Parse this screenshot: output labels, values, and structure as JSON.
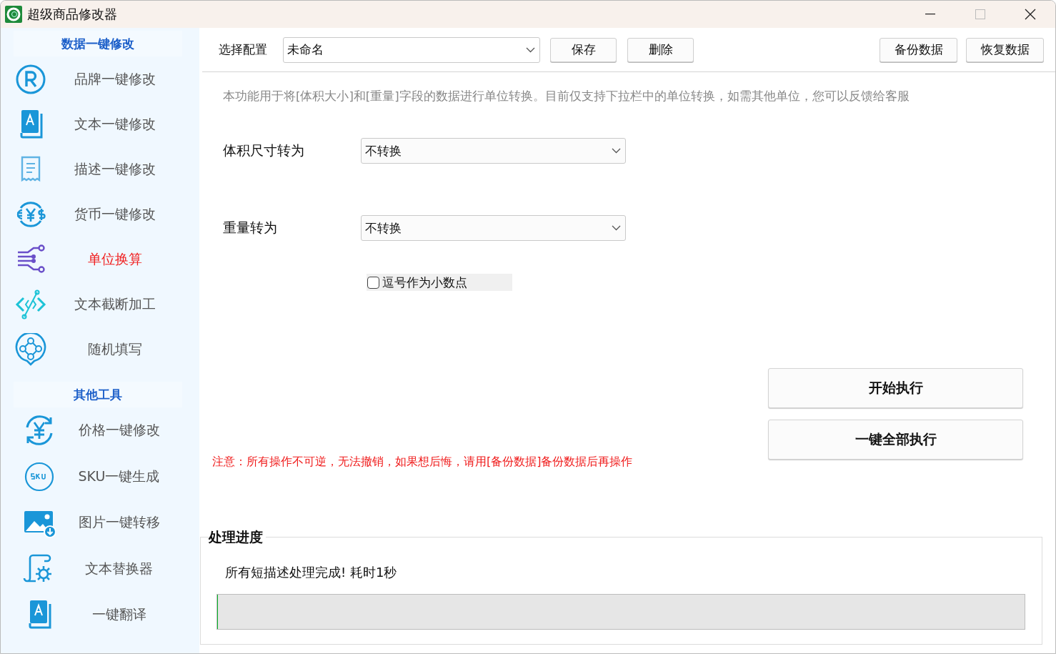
{
  "window": {
    "title": "超级商品修改器"
  },
  "sidebar": {
    "groups": [
      {
        "header": "数据一键修改",
        "items": [
          {
            "label": "品牌一键修改",
            "selected": false
          },
          {
            "label": "文本一键修改",
            "selected": false
          },
          {
            "label": "描述一键修改",
            "selected": false
          },
          {
            "label": "货币一键修改",
            "selected": false
          },
          {
            "label": "单位换算",
            "selected": true
          },
          {
            "label": "文本截断加工",
            "selected": false
          },
          {
            "label": "随机填写",
            "selected": false
          }
        ]
      },
      {
        "header": "其他工具",
        "items": [
          {
            "label": "价格一键修改",
            "selected": false
          },
          {
            "label": "SKU一键生成",
            "selected": false
          },
          {
            "label": "图片一键转移",
            "selected": false
          },
          {
            "label": "文本替换器",
            "selected": false
          },
          {
            "label": "一键翻译",
            "selected": false
          }
        ]
      }
    ]
  },
  "toolbar": {
    "config_label": "选择配置",
    "config_value": "未命名",
    "buttons": [
      "保存",
      "删除"
    ],
    "right_buttons": [
      "备份数据",
      "恢复数据"
    ]
  },
  "description": "本功能用于将[体积大小]和[重量]字段的数据进行单位转换。目前仅支持下拉栏中的单位转换，如需其他单位，您可以反馈给客服",
  "form": [
    {
      "label": "体积尺寸转为",
      "value": "不转换"
    },
    {
      "label": "重量转为",
      "value": "不转换"
    }
  ],
  "checkbox": {
    "label": "逗号作为小数点",
    "checked": false
  },
  "actions": [
    "开始执行",
    "一键全部执行"
  ],
  "warning": "注意：所有操作不可逆，无法撤销，如果想后悔，请用[备份数据]备份数据后再操作",
  "progress": {
    "title": "处理进度",
    "status": "所有短描述处理完成! 耗时1秒",
    "level": 0
  }
}
